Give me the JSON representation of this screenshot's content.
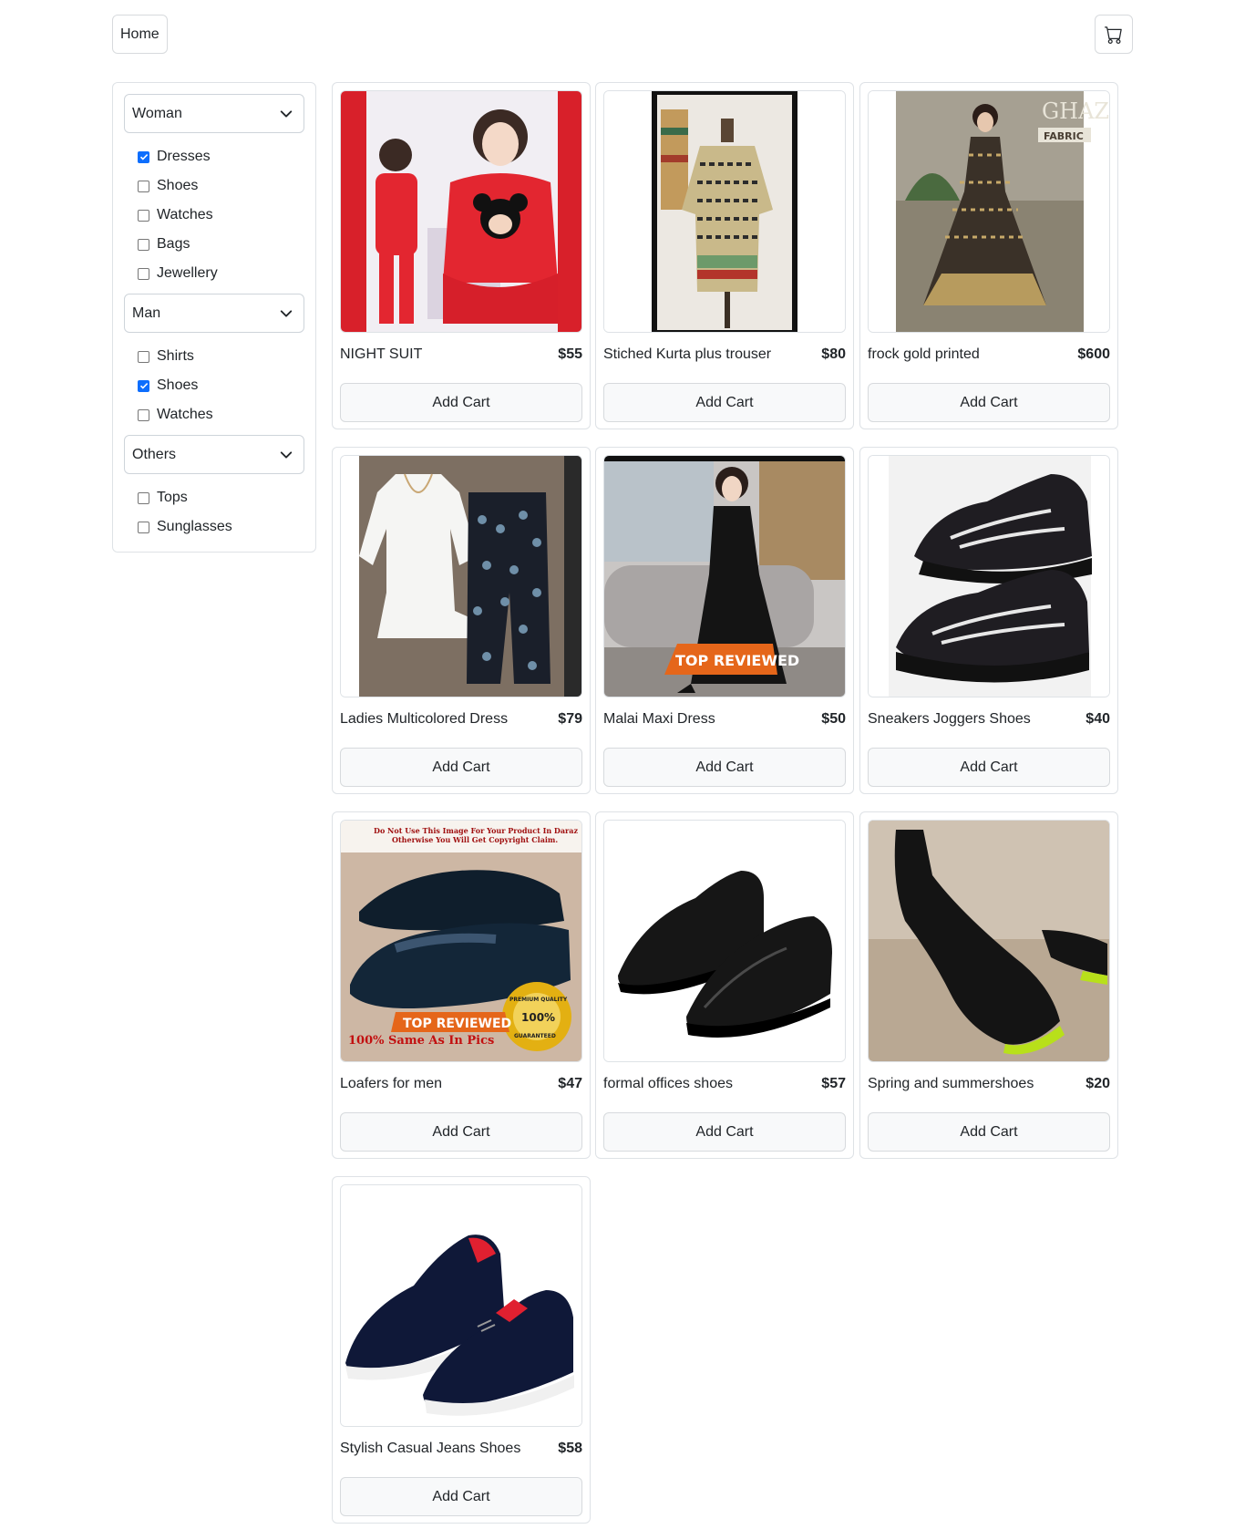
{
  "header": {
    "home_label": "Home",
    "cart_icon": "cart-icon"
  },
  "sidebar": {
    "groups": [
      {
        "label": "Woman",
        "items": [
          {
            "label": "Dresses",
            "checked": true
          },
          {
            "label": "Shoes",
            "checked": false
          },
          {
            "label": "Watches",
            "checked": false
          },
          {
            "label": "Bags",
            "checked": false
          },
          {
            "label": "Jewellery",
            "checked": false
          }
        ]
      },
      {
        "label": "Man",
        "items": [
          {
            "label": "Shirts",
            "checked": false
          },
          {
            "label": "Shoes",
            "checked": true
          },
          {
            "label": "Watches",
            "checked": false
          }
        ]
      },
      {
        "label": "Others",
        "items": [
          {
            "label": "Tops",
            "checked": false
          },
          {
            "label": "Sunglasses",
            "checked": false
          }
        ]
      }
    ]
  },
  "products": [
    {
      "name": "NIGHT SUIT",
      "price": "$55",
      "button": "Add Cart"
    },
    {
      "name": "Stiched Kurta plus trouser",
      "price": "$80",
      "button": "Add Cart"
    },
    {
      "name": "frock gold printed",
      "price": "$600",
      "button": "Add Cart"
    },
    {
      "name": "Ladies Multicolored Dress",
      "price": "$79",
      "button": "Add Cart"
    },
    {
      "name": "Malai Maxi Dress",
      "price": "$50",
      "button": "Add Cart"
    },
    {
      "name": "Sneakers Joggers Shoes",
      "price": "$40",
      "button": "Add Cart"
    },
    {
      "name": "Loafers for men",
      "price": "$47",
      "button": "Add Cart"
    },
    {
      "name": "formal offices shoes",
      "price": "$57",
      "button": "Add Cart"
    },
    {
      "name": "Spring and summershoes",
      "price": "$20",
      "button": "Add Cart"
    },
    {
      "name": "Stylish Casual Jeans Shoes",
      "price": "$58",
      "button": "Add Cart"
    }
  ],
  "image_texts": {
    "ghazi": "GHAZI",
    "fabric": "FABRIC",
    "top_reviewed": "TOP REVIEWED",
    "copyright_1": "Do Not Use This Image For Your Product In Daraz",
    "copyright_2": "Otherwise You Will Get Copyright Claim.",
    "same_as_pics": "100% Same As In Pics",
    "seal_100": "100%",
    "seal_quality": "PREMIUM QUALITY",
    "seal_guaranteed": "GUARANTEED"
  }
}
